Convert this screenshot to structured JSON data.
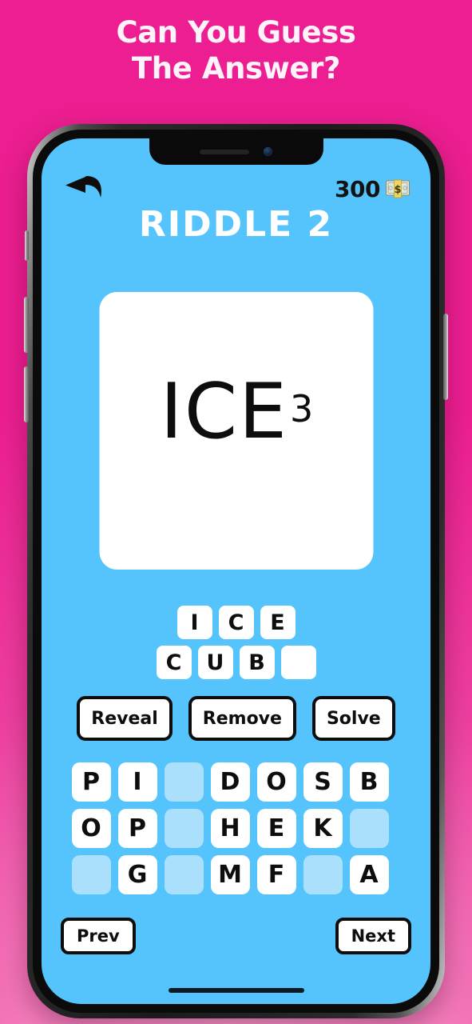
{
  "promo": {
    "headline_line1": "Can You Guess",
    "headline_line2": "The Answer?",
    "background_color": "#EC1E91",
    "headline_color": "#FFF3FA"
  },
  "device": {
    "frame_color": "#1b1b1b",
    "screen_color": "#55C4FC",
    "notch": {
      "speaker_label": "earpiece-speaker",
      "camera_label": "front-camera"
    },
    "side_buttons": [
      "mute-switch",
      "volume-up",
      "volume-down",
      "power"
    ]
  },
  "app": {
    "back_icon": "back-arrow-icon",
    "coin_count": "300",
    "coin_icon": "banknote-icon",
    "title": "RIDDLE 2"
  },
  "puzzle": {
    "card_background": "#FFFFFF",
    "rebus_base": "ICE",
    "rebus_exponent": "3"
  },
  "answer": {
    "rows": [
      {
        "tiles": [
          "I",
          "C",
          "E"
        ]
      },
      {
        "tiles": [
          "C",
          "U",
          "B",
          ""
        ]
      }
    ]
  },
  "actions": {
    "buttons": [
      {
        "label": "Reveal",
        "name": "reveal-button"
      },
      {
        "label": "Remove",
        "name": "remove-button"
      },
      {
        "label": "Solve",
        "name": "solve-button"
      }
    ]
  },
  "keyboard": {
    "used_key_color": "#ABE0FD",
    "rows": [
      [
        {
          "letter": "P",
          "used": false
        },
        {
          "letter": "I",
          "used": false
        },
        {
          "letter": "",
          "used": true
        },
        {
          "letter": "D",
          "used": false
        },
        {
          "letter": "O",
          "used": false
        },
        {
          "letter": "S",
          "used": false
        },
        {
          "letter": "B",
          "used": false
        }
      ],
      [
        {
          "letter": "O",
          "used": false
        },
        {
          "letter": "P",
          "used": false
        },
        {
          "letter": "",
          "used": true
        },
        {
          "letter": "H",
          "used": false
        },
        {
          "letter": "E",
          "used": false
        },
        {
          "letter": "K",
          "used": false
        },
        {
          "letter": "",
          "used": true
        }
      ],
      [
        {
          "letter": "",
          "used": true
        },
        {
          "letter": "G",
          "used": false
        },
        {
          "letter": "",
          "used": true
        },
        {
          "letter": "M",
          "used": false
        },
        {
          "letter": "F",
          "used": false
        },
        {
          "letter": "",
          "used": true
        },
        {
          "letter": "A",
          "used": false
        }
      ]
    ]
  },
  "navigation": {
    "prev_label": "Prev",
    "next_label": "Next"
  }
}
